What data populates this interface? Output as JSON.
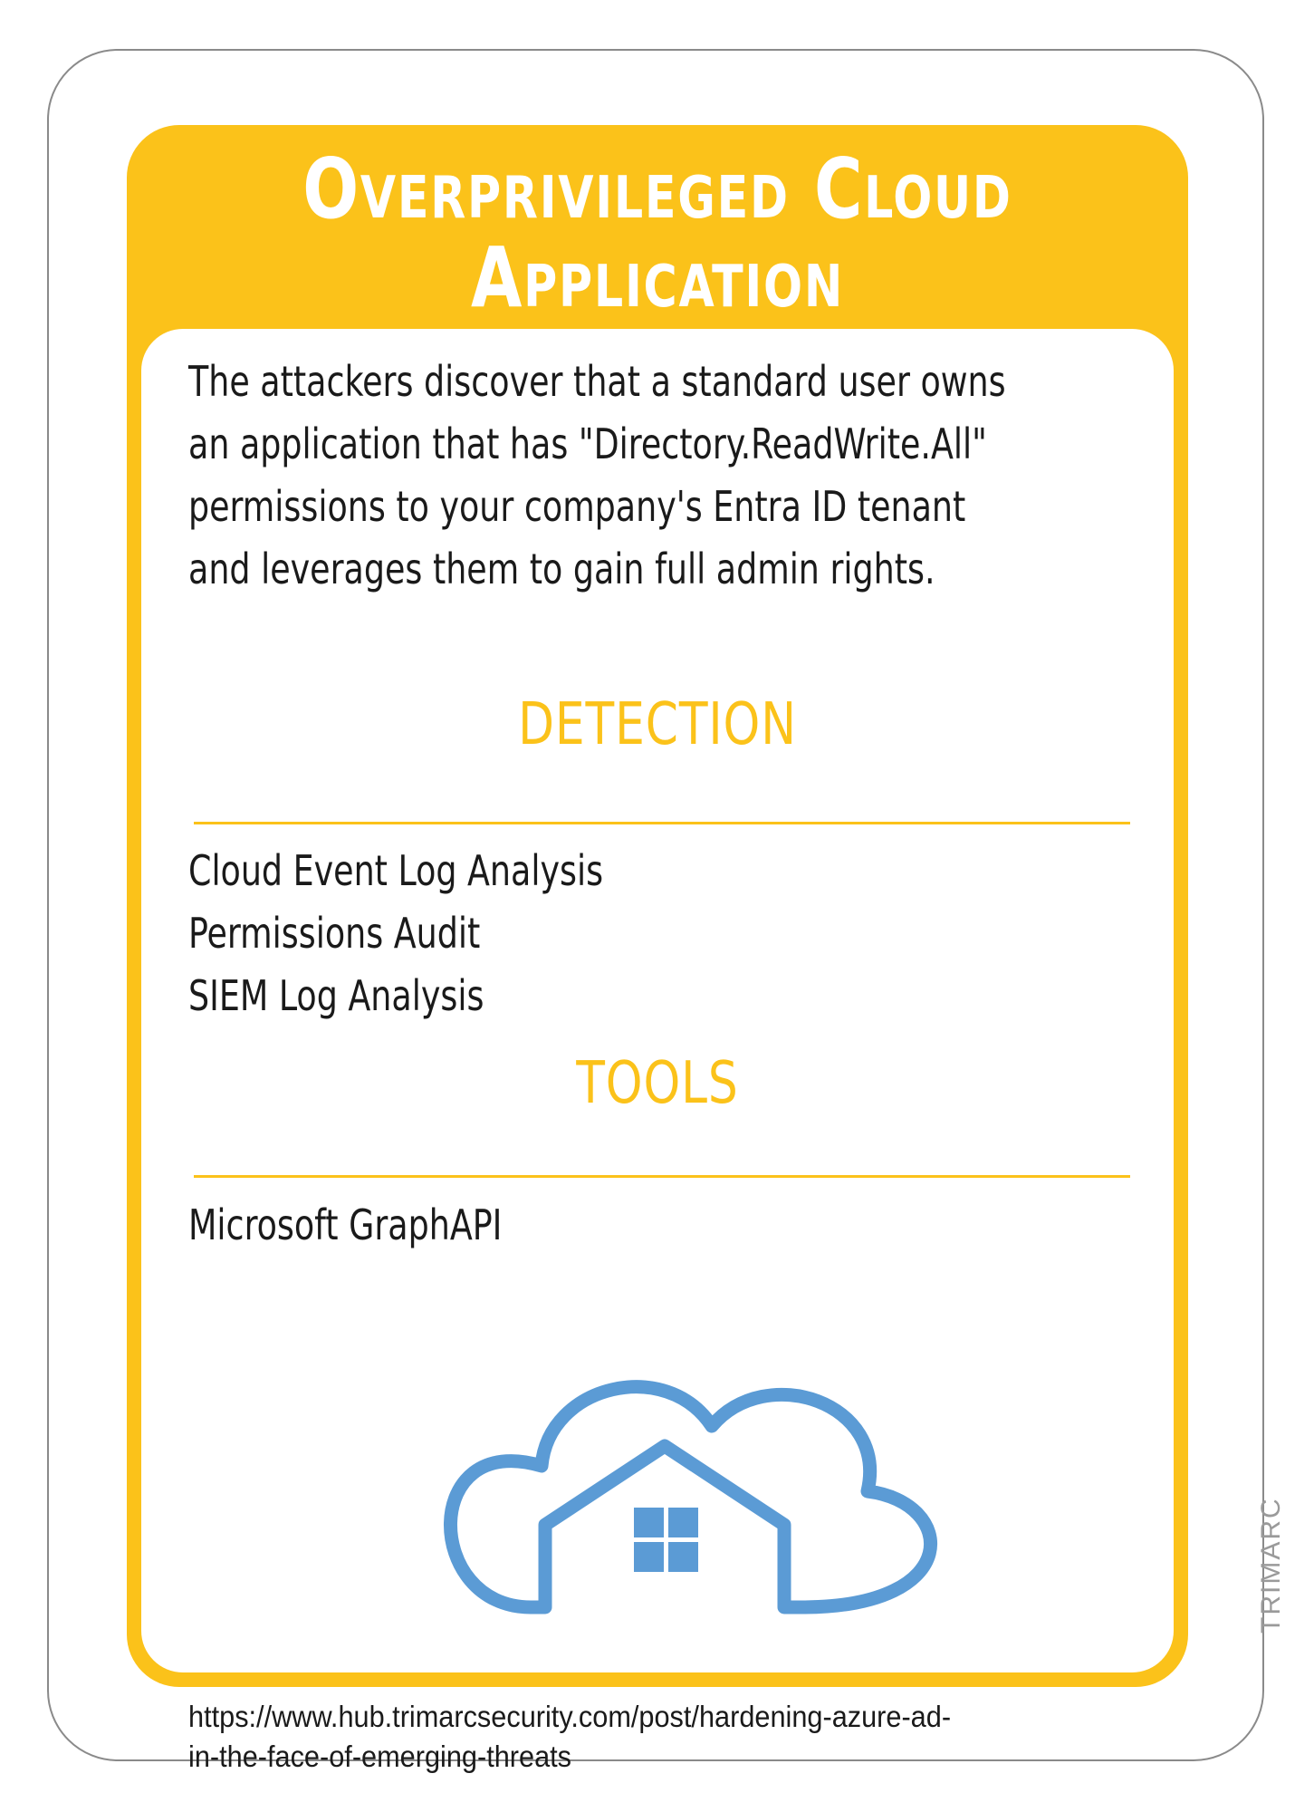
{
  "card": {
    "title": "Overprivileged Cloud Application",
    "description": "The attackers discover that a standard user owns\nan application that has \"Directory.ReadWrite.All\"\npermissions to your company's Entra ID tenant\nand leverages them to gain full admin rights.",
    "detection": {
      "heading": "DETECTION",
      "items": [
        "Cloud Event Log Analysis",
        "Permissions Audit",
        "SIEM Log Analysis"
      ]
    },
    "tools": {
      "heading": "TOOLS",
      "items": [
        "Microsoft GraphAPI"
      ]
    },
    "reference_url": "https://www.hub.trimarcsecurity.com/post/hardening-azure-ad-\nin-the-face-of-emerging-threats",
    "brand": "TRIMARC",
    "icon": "cloud-house-icon"
  },
  "colors": {
    "accent": "#fbc21a",
    "icon_blue": "#5b9bd5",
    "text": "#1a1a1a",
    "border": "#8a8a8a"
  }
}
